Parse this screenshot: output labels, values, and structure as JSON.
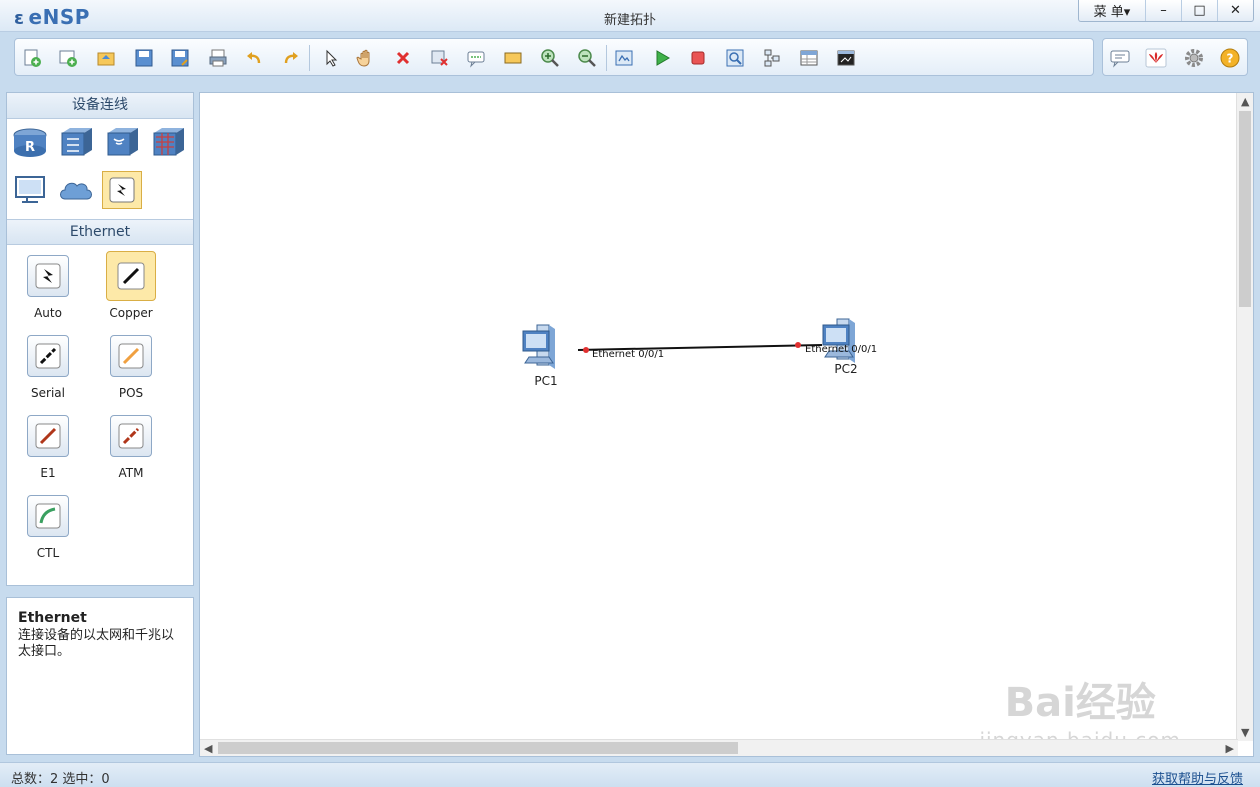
{
  "app": {
    "logo": "eNSP",
    "title": "新建拓扑"
  },
  "window_controls": {
    "menu": "菜 单▾",
    "minimize": "–",
    "maximize": "□",
    "close": "✕"
  },
  "toolbar": {
    "buttons": [
      "new-topology",
      "new-lab",
      "open",
      "save",
      "save-as",
      "print",
      "undo",
      "redo",
      "select",
      "pan",
      "delete",
      "delete-connection",
      "text-note",
      "palette",
      "zoom-in",
      "zoom-out",
      "fit",
      "start-device",
      "stop-device",
      "capture",
      "topology-view",
      "interface-table",
      "terminal"
    ],
    "right_buttons": [
      "chat",
      "huawei",
      "settings",
      "help"
    ]
  },
  "device_panel": {
    "title": "设备连线",
    "device_types": [
      "router",
      "switch",
      "wlan",
      "firewall",
      "pc",
      "cloud",
      "connection"
    ],
    "selected": "connection"
  },
  "connection_panel": {
    "title": "Ethernet",
    "items": [
      {
        "label": "Auto",
        "color": "#111111"
      },
      {
        "label": "Copper",
        "color": "#111111",
        "selected": true
      },
      {
        "label": "Serial",
        "color": "#111111"
      },
      {
        "label": "POS",
        "color": "#f0a040"
      },
      {
        "label": "E1",
        "color": "#b0361a"
      },
      {
        "label": "ATM",
        "color": "#b0361a"
      },
      {
        "label": "CTL",
        "color": "#3aa060"
      }
    ]
  },
  "description": {
    "title": "Ethernet",
    "text": "连接设备的以太网和千兆以太接口。"
  },
  "topology": {
    "nodes": [
      {
        "name": "PC1",
        "interface": "Ethernet 0/0/1"
      },
      {
        "name": "PC2",
        "interface": "Ethernet 0/0/1"
      }
    ],
    "links": [
      {
        "from": "PC1",
        "to": "PC2",
        "type": "Copper"
      }
    ]
  },
  "watermark": {
    "line1": "Bai经验",
    "line2": "jingyan.baidu.com"
  },
  "status": {
    "text": "总数：2  选中：0",
    "help_link": "获取帮助与反馈"
  },
  "colors": {
    "accent": "#3a6fb3",
    "link_dot": "#e03030"
  }
}
